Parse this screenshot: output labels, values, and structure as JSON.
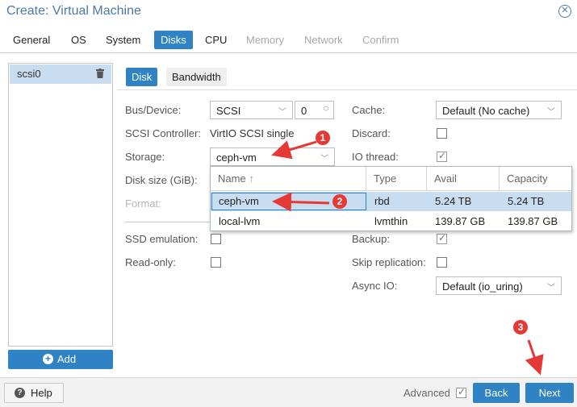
{
  "window": {
    "title": "Create: Virtual Machine"
  },
  "tabs": [
    "General",
    "OS",
    "System",
    "Disks",
    "CPU",
    "Memory",
    "Network",
    "Confirm"
  ],
  "disk_list": {
    "items": [
      "scsi0"
    ],
    "add_label": "Add"
  },
  "subtabs": [
    "Disk",
    "Bandwidth"
  ],
  "form": {
    "bus_device": {
      "label": "Bus/Device:",
      "bus": "SCSI",
      "device": "0"
    },
    "scsi_controller": {
      "label": "SCSI Controller:",
      "value": "VirtIO SCSI single"
    },
    "storage": {
      "label": "Storage:",
      "value": "ceph-vm"
    },
    "disk_size": {
      "label": "Disk size (GiB):"
    },
    "format": {
      "label": "Format:"
    },
    "ssd_emulation": {
      "label": "SSD emulation:"
    },
    "read_only": {
      "label": "Read-only:"
    },
    "cache": {
      "label": "Cache:",
      "value": "Default (No cache)"
    },
    "discard": {
      "label": "Discard:"
    },
    "io_thread": {
      "label": "IO thread:"
    },
    "backup": {
      "label": "Backup:"
    },
    "skip_replication": {
      "label": "Skip replication:"
    },
    "async_io": {
      "label": "Async IO:",
      "value": "Default (io_uring)"
    }
  },
  "storage_dropdown": {
    "columns": [
      "Name",
      "Type",
      "Avail",
      "Capacity"
    ],
    "sort_indicator": "↑",
    "rows": [
      {
        "name": "ceph-vm",
        "type": "rbd",
        "avail": "5.24 TB",
        "capacity": "5.24 TB"
      },
      {
        "name": "local-lvm",
        "type": "lvmthin",
        "avail": "139.87 GB",
        "capacity": "139.87 GB"
      }
    ]
  },
  "footer": {
    "help": "Help",
    "advanced": "Advanced",
    "back": "Back",
    "next": "Next"
  },
  "annotations": [
    "1",
    "2",
    "3"
  ],
  "colors": {
    "accent": "#2f83c4",
    "selection": "#c9ddf1",
    "annotation": "#e53935",
    "title": "#4a79a8"
  }
}
